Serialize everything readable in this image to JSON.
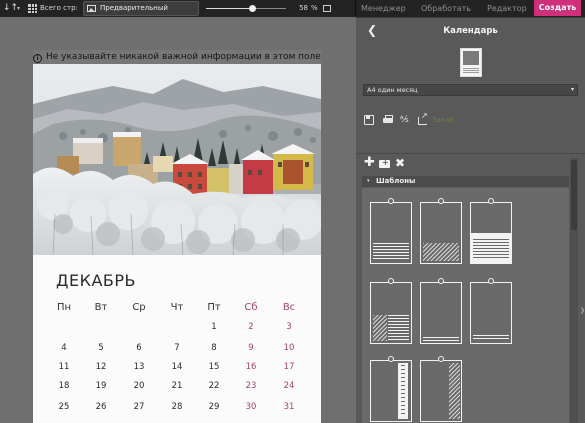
{
  "toolbar": {
    "sort_glyph": "↓↑",
    "caret": "▾",
    "all_pages_label": "Всего стр:",
    "preview_label": "Предварительный просмотр",
    "zoom_value": "58",
    "zoom_unit": "%",
    "zoom_fraction": 0.58
  },
  "menu": {
    "tabs": [
      "Менеджер",
      "Обработать",
      "Редактор"
    ],
    "create_label": "Создать"
  },
  "colors": {
    "accent": "#cf2f7b",
    "weekend": "#a2456a",
    "panel": "#595959",
    "workspace": "#6f6f6f"
  },
  "notice": {
    "icon": "info-icon",
    "text": "Не указывайте никакой важной информации в этом поле"
  },
  "calendar": {
    "month": "ДЕКАБРЬ",
    "weekdays": [
      "Пн",
      "Вт",
      "Ср",
      "Чт",
      "Пт",
      "Сб",
      "Вс"
    ],
    "weeks": [
      [
        "",
        "",
        "",
        "",
        "1",
        "2",
        "3"
      ],
      [
        "4",
        "5",
        "6",
        "7",
        "8",
        "9",
        "10"
      ],
      [
        "11",
        "12",
        "13",
        "14",
        "15",
        "16",
        "17"
      ],
      [
        "18",
        "19",
        "20",
        "21",
        "22",
        "23",
        "24"
      ],
      [
        "25",
        "26",
        "27",
        "28",
        "29",
        "30",
        "31"
      ]
    ]
  },
  "panel": {
    "back_glyph": "❮",
    "title": "Календарь",
    "format_select": "А4 один месяц",
    "select_arrow": "▾",
    "fx_glyph": "⅍",
    "cart_label": "Заказ",
    "plus_glyph": "✚",
    "delete_glyph": "✖",
    "templates_header": "Шаблоны",
    "templates_toggle": "▾",
    "side_arrow": "❯"
  }
}
